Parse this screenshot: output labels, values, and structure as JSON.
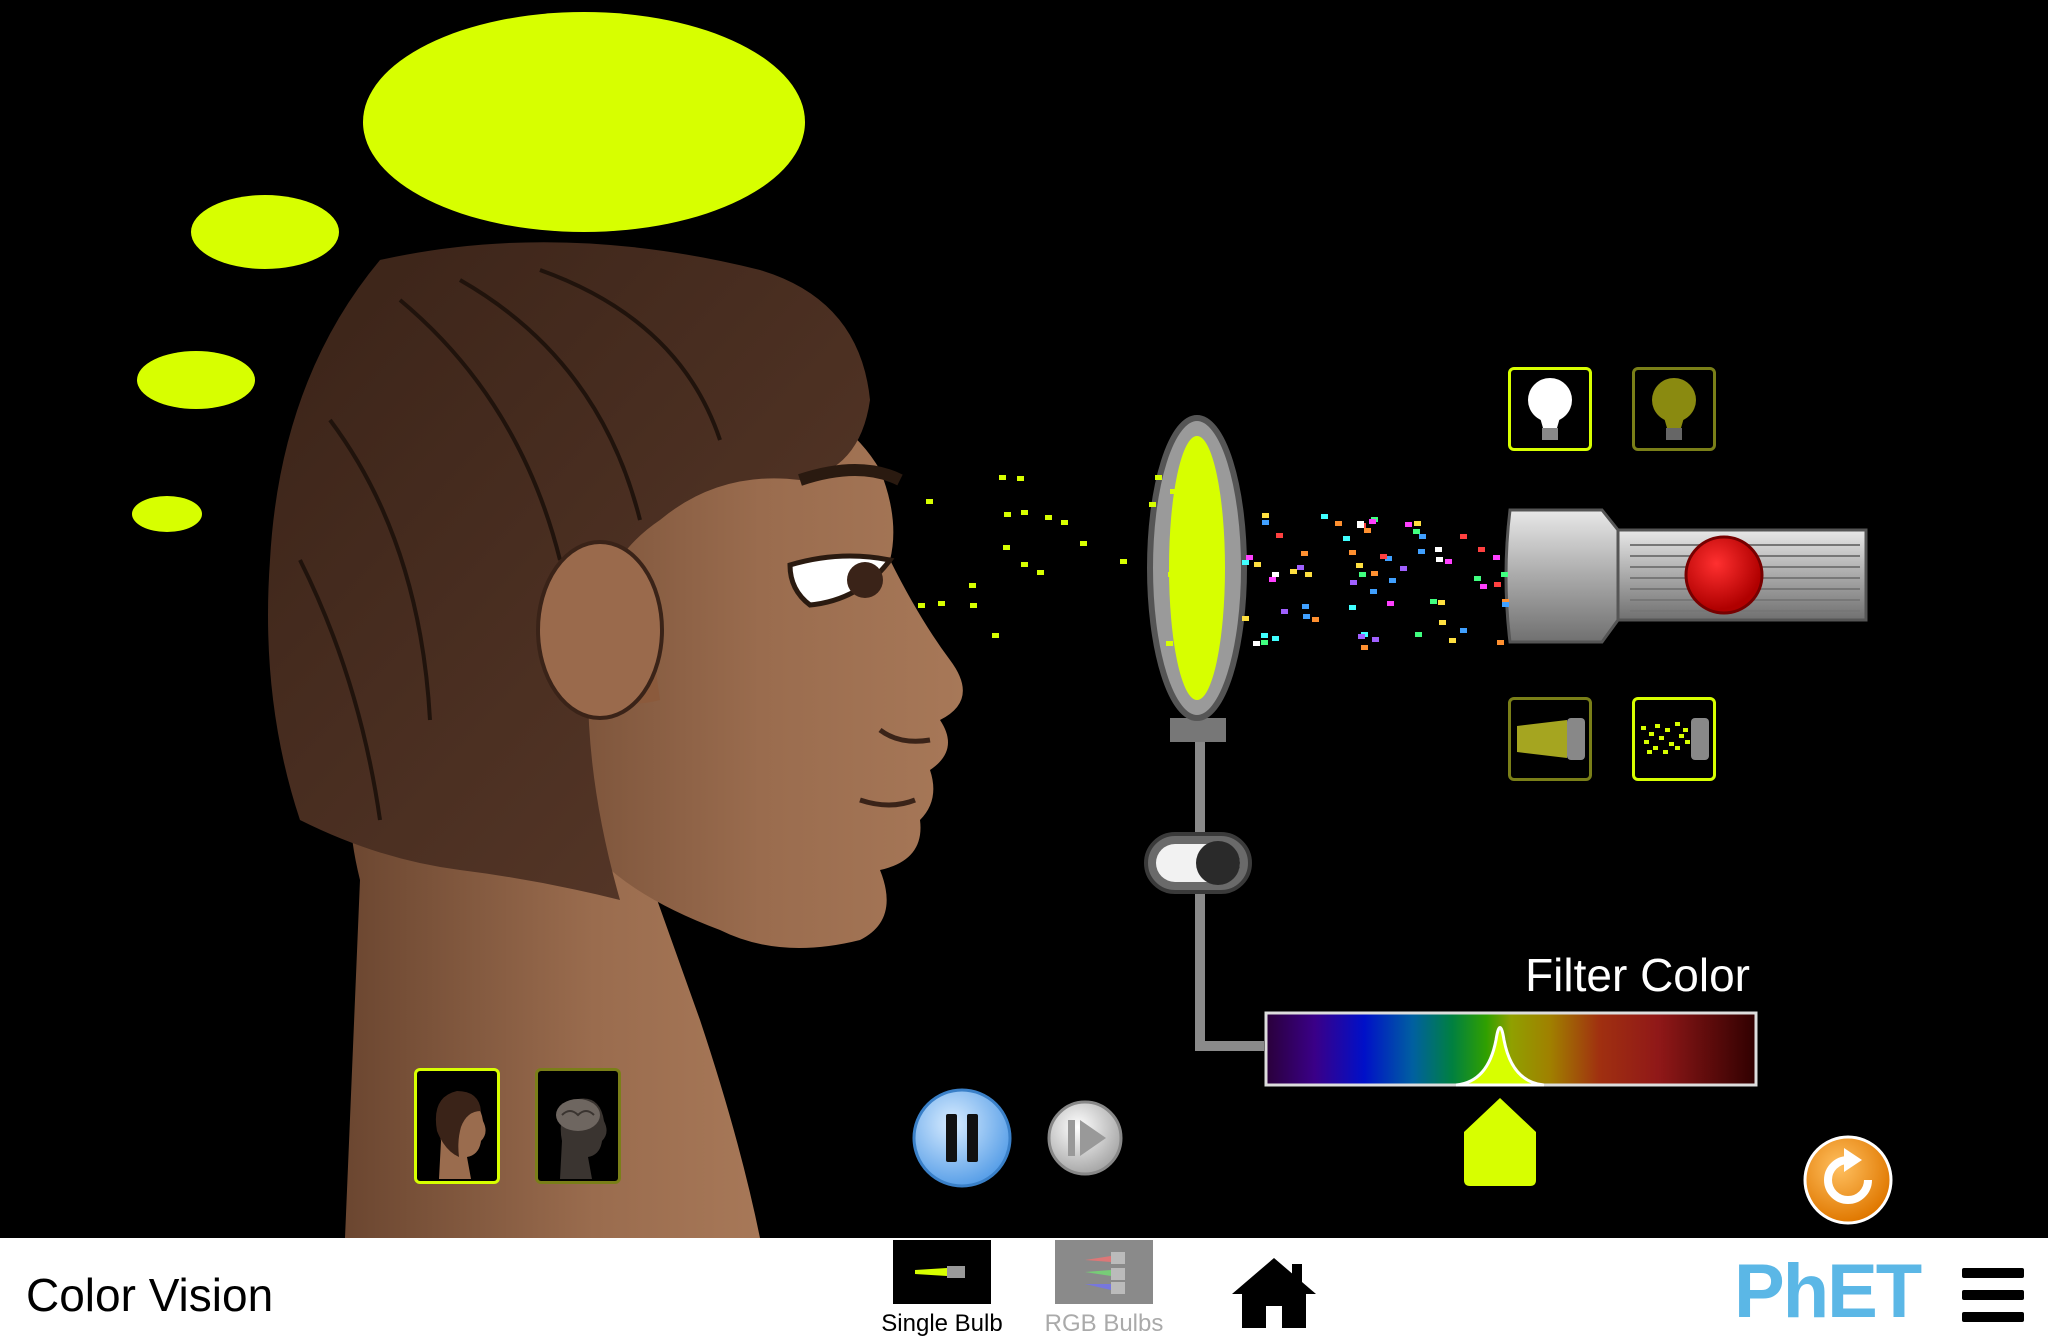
{
  "app": {
    "title": "Color Vision"
  },
  "colors": {
    "perceived": "#d7ff00",
    "selection_border": "#d7ff00",
    "background": "#000000",
    "reset": "#f39c12",
    "play": "#8fc7ff"
  },
  "thought_bubble": {
    "color": "#d7ff00"
  },
  "filter": {
    "label": "Filter Color",
    "enabled": true,
    "selected_color": "#d7ff00"
  },
  "controls": {
    "pause_icon": "pause-icon",
    "step_icon": "step-forward-icon",
    "reset_icon": "reset-arrow-icon"
  },
  "bulb_type": {
    "options": [
      "white-light",
      "colored-light"
    ],
    "selected": "white-light"
  },
  "beam_type": {
    "options": [
      "solid-beam",
      "photon-beam"
    ],
    "selected": "photon-beam"
  },
  "view": {
    "options": [
      "head-view",
      "brain-view"
    ],
    "selected": "head-view"
  },
  "navbar": {
    "screens": [
      {
        "label": "Single Bulb",
        "selected": true
      },
      {
        "label": "RGB Bulbs",
        "selected": false
      }
    ],
    "home_icon": "home-icon",
    "brand": "PhET",
    "menu_icon": "hamburger-menu-icon"
  }
}
